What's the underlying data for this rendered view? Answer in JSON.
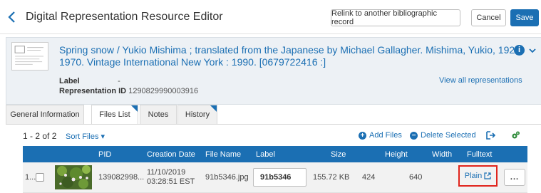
{
  "header": {
    "title": "Digital Representation Resource Editor",
    "relink_label": "Relink to another bibliographic record",
    "cancel_label": "Cancel",
    "save_label": "Save"
  },
  "record": {
    "title_line1": "Spring snow / Yukio Mishima ; translated from the Japanese by Michael Gallagher. Mishima, Yukio, 192",
    "title_line2": "1970. Vintage International New York : 1990. [0679722416 :]",
    "label_key": "Label",
    "label_value": "-",
    "rep_id_key": "Representation ID",
    "rep_id_value": "1290829990003916",
    "view_all": "View all representations",
    "info_glyph": "i"
  },
  "tabs": [
    {
      "label": "General Information"
    },
    {
      "label": "Files List"
    },
    {
      "label": "Notes"
    },
    {
      "label": "History"
    }
  ],
  "toolbar": {
    "count": "1 - 2 of 2",
    "sort": "Sort Files ▾",
    "add_files": "Add Files",
    "delete_selected": "Delete Selected"
  },
  "table": {
    "headers": [
      "PID",
      "Creation Date",
      "File Name",
      "Label",
      "Size",
      "Height",
      "Width",
      "Fulltext"
    ],
    "row": {
      "index": "1...",
      "pid": "139082998...",
      "creation_date_1": "11/10/2019",
      "creation_date_2": "03:28:51 EST",
      "file_name": "91b5346.jpg",
      "label": "91b5346",
      "size": "155.72 KB",
      "height": "424",
      "width": "640",
      "fulltext": "Plain",
      "more": "..."
    }
  },
  "colors": {
    "accent": "#1b6fb3",
    "highlight_box": "#e0241c"
  }
}
